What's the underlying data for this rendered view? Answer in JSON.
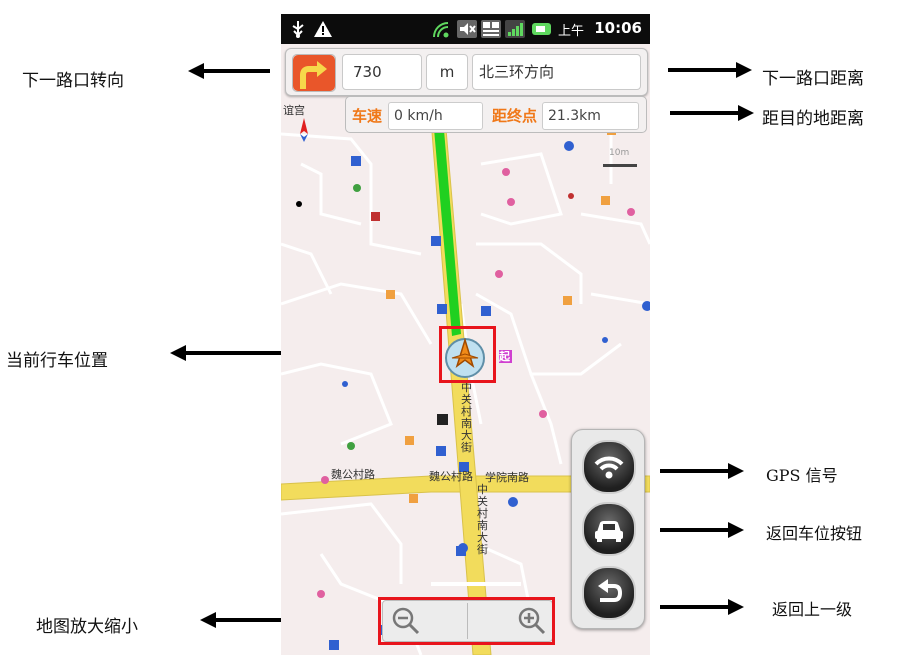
{
  "annotations": {
    "next_turn": "下一路口转向",
    "next_distance": "下一路口距离",
    "destination_distance": "距目的地距离",
    "current_position": "当前行车位置",
    "gps_signal": "GPS 信号",
    "return_vehicle": "返回车位按钮",
    "go_back": "返回上一级",
    "zoom": "地图放大缩小"
  },
  "status_bar": {
    "ampm": "上午",
    "time": "10:06",
    "icons": [
      "usb-icon",
      "warning-icon",
      "signal-sync-icon",
      "mute-icon",
      "3g-icon",
      "cell-signal-icon",
      "battery-icon"
    ]
  },
  "navigation": {
    "turn_icon": "turn-right-icon",
    "distance_value": "730",
    "distance_unit": "m",
    "direction": "北三环方向",
    "speed_label": "车速",
    "speed_value": "0 km/h",
    "remaining_label": "距终点",
    "remaining_value": "21.3km"
  },
  "map_labels": {
    "left_edge": "谊宫",
    "street_1": "魏公村路",
    "street_2": "魏公村路",
    "street_3": "学院南路",
    "avenue_1": "中关村南大街",
    "avenue_2": "中关村南大街",
    "start_marker": "起",
    "scale": "10m"
  },
  "controls": {
    "gps_button_icon": "wifi-signal-icon",
    "car_button_icon": "car-icon",
    "back_button_icon": "undo-arrow-icon",
    "zoom_out_icon": "zoom-out-icon",
    "zoom_in_icon": "zoom-in-icon"
  },
  "colors": {
    "route_green": "#20d020",
    "road_yellow": "#f2dc5c",
    "highlight_red": "#e8141c",
    "label_orange": "#f07818"
  }
}
